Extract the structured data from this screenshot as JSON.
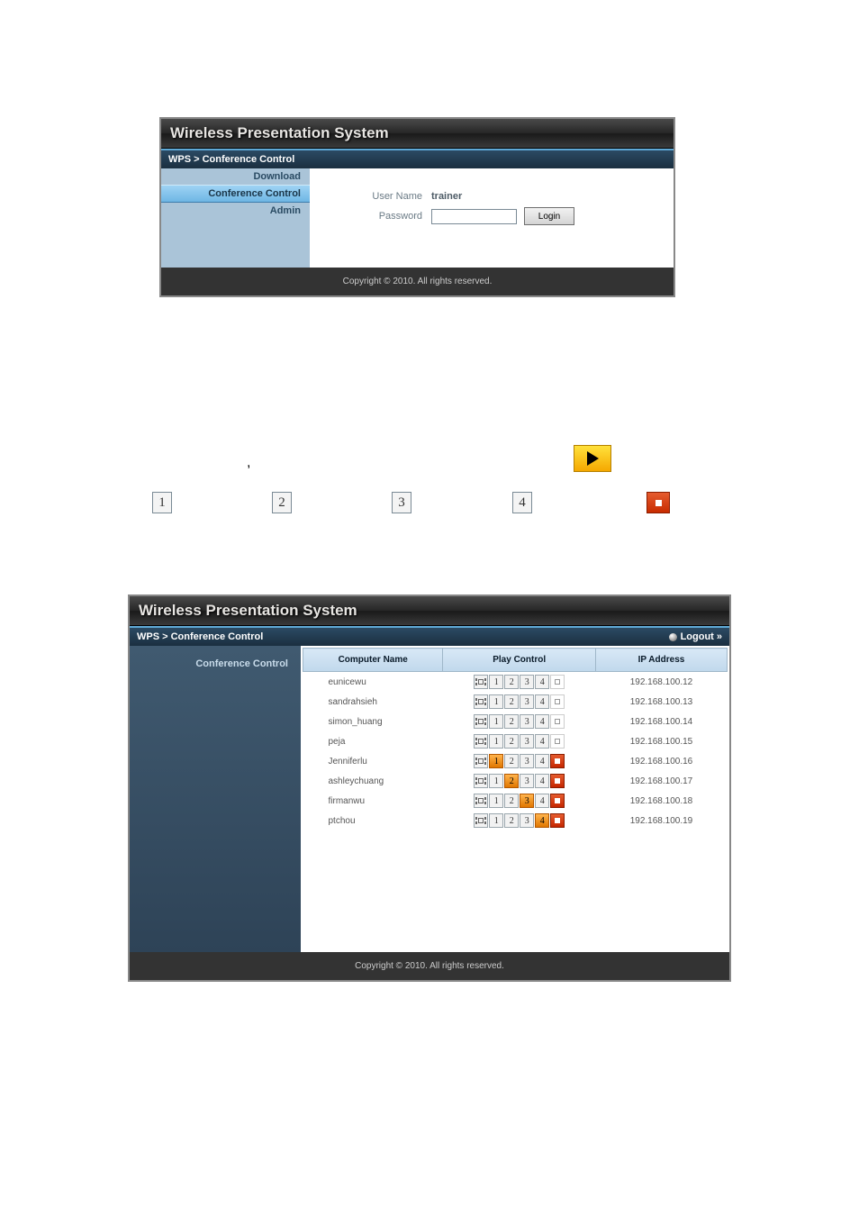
{
  "panel1": {
    "title": "Wireless Presentation System",
    "breadcrumb": "WPS > Conference Control",
    "nav": {
      "download": "Download",
      "conf": "Conference Control",
      "admin": "Admin"
    },
    "login": {
      "user_label": "User Name",
      "user_value": "trainer",
      "pass_label": "Password",
      "button": "Login"
    },
    "footer": "Copyright © 2010. All rights reserved."
  },
  "mid": {
    "n1": "1",
    "n2": "2",
    "n3": "3",
    "n4": "4"
  },
  "panel2": {
    "title": "Wireless Presentation System",
    "breadcrumb": "WPS > Conference Control",
    "logout": "Logout »",
    "side": "Conference Control",
    "headers": {
      "name": "Computer Name",
      "play": "Play Control",
      "ip": "IP Address"
    },
    "rows": [
      {
        "name": "eunicewu",
        "ip": "192.168.100.12",
        "active": 0,
        "stop": false
      },
      {
        "name": "sandrahsieh",
        "ip": "192.168.100.13",
        "active": 0,
        "stop": false
      },
      {
        "name": "simon_huang",
        "ip": "192.168.100.14",
        "active": 0,
        "stop": false
      },
      {
        "name": "peja",
        "ip": "192.168.100.15",
        "active": 0,
        "stop": false
      },
      {
        "name": "Jenniferlu",
        "ip": "192.168.100.16",
        "active": 1,
        "stop": true
      },
      {
        "name": "ashleychuang",
        "ip": "192.168.100.17",
        "active": 2,
        "stop": true
      },
      {
        "name": "firmanwu",
        "ip": "192.168.100.18",
        "active": 3,
        "stop": true
      },
      {
        "name": "ptchou",
        "ip": "192.168.100.19",
        "active": 4,
        "stop": true
      }
    ],
    "footer": "Copyright © 2010. All rights reserved."
  }
}
